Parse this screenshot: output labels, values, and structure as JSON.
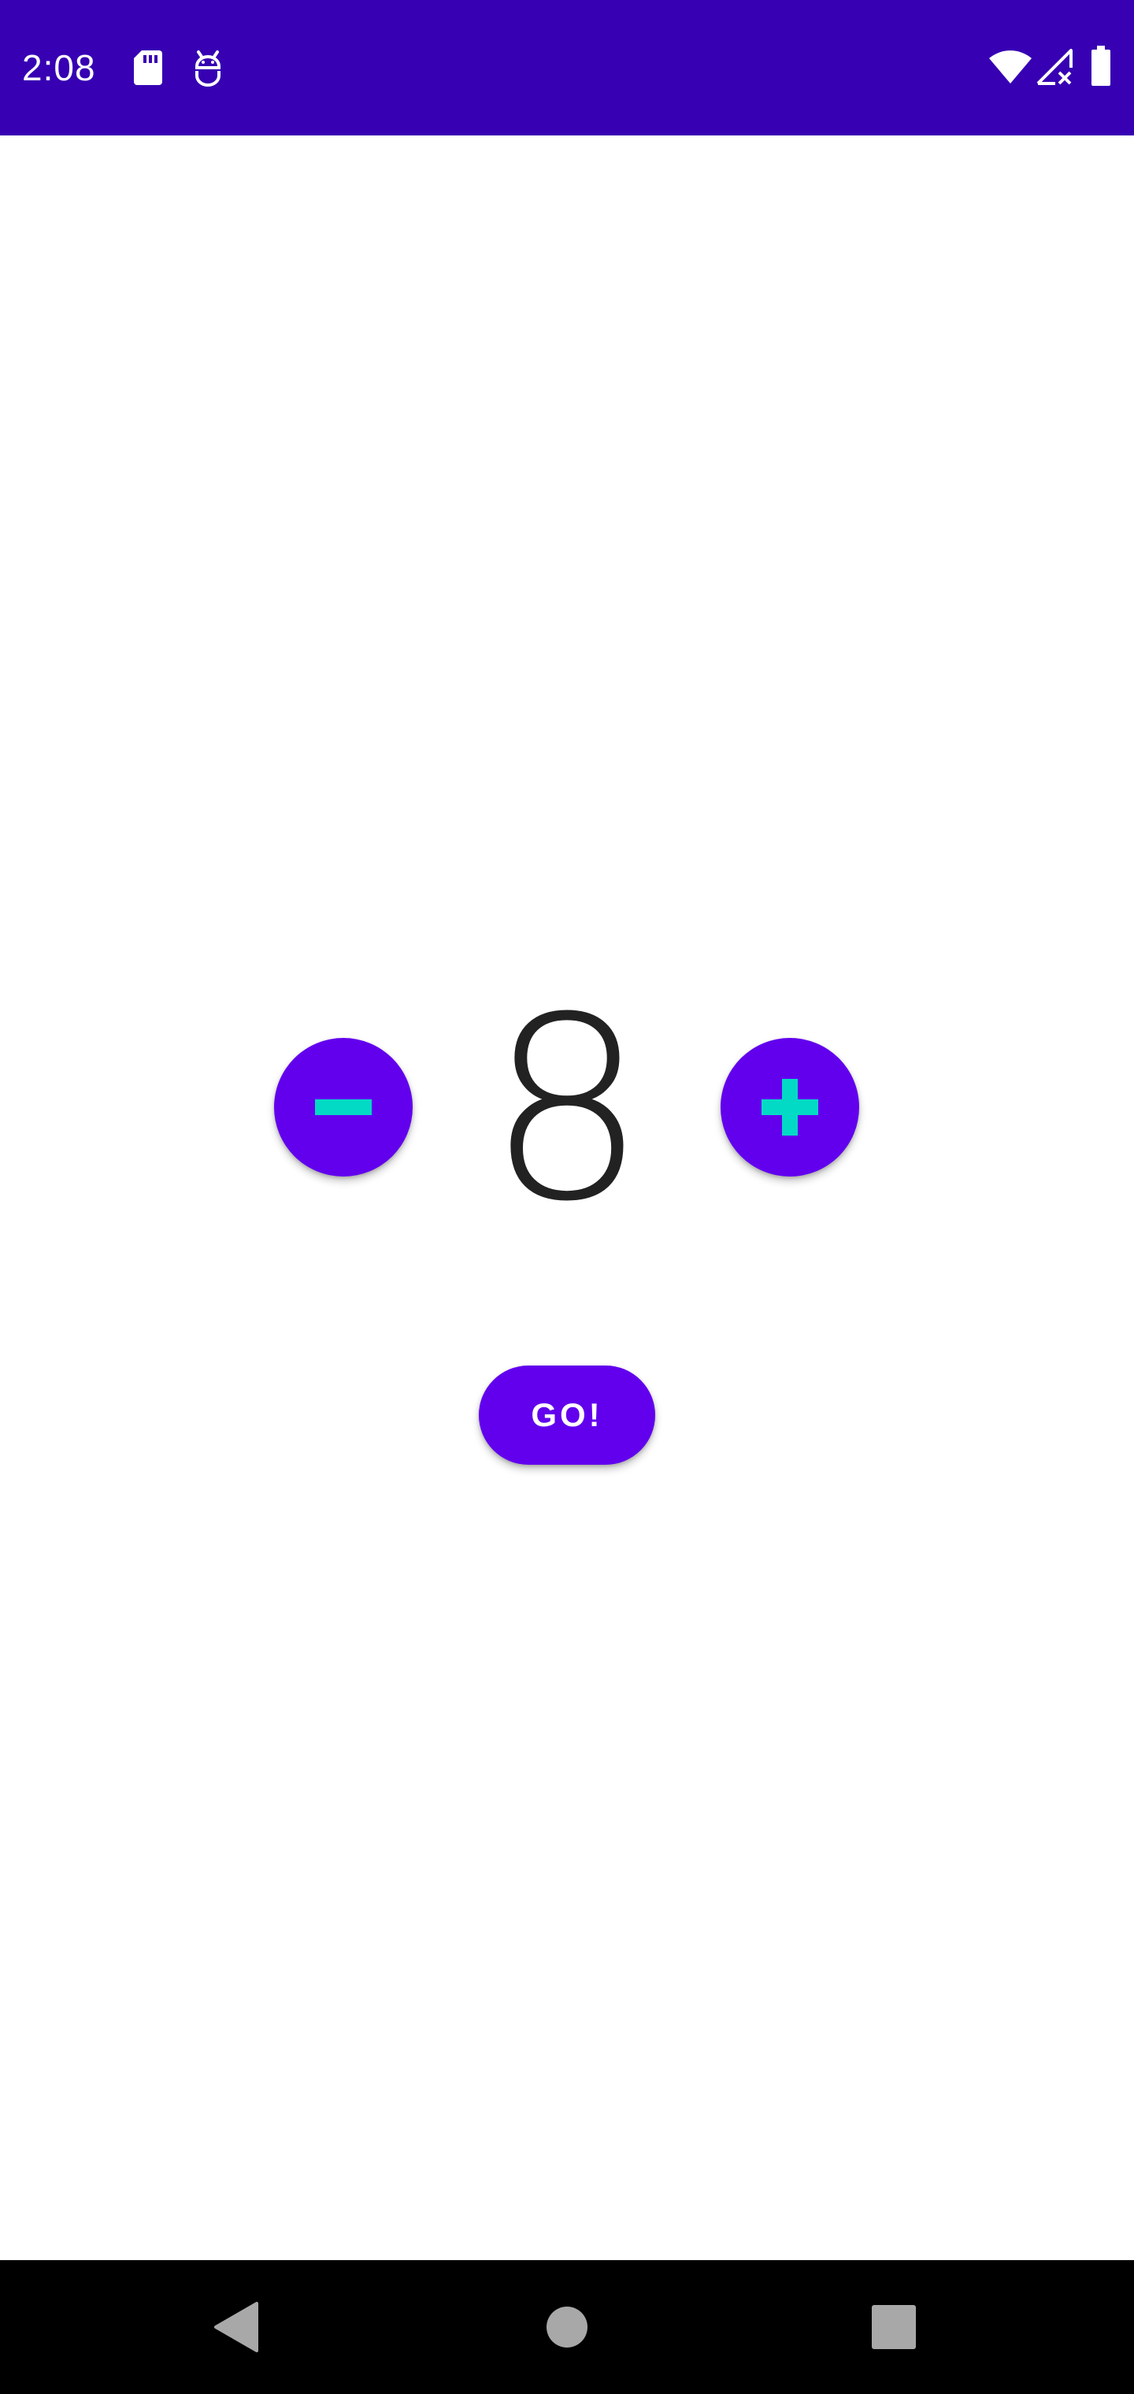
{
  "status_bar": {
    "time": "2:08",
    "left_icons": [
      "sd-card-icon",
      "android-debug-icon"
    ],
    "right_icons": [
      "wifi-icon",
      "cellular-no-signal-icon",
      "battery-icon"
    ],
    "background_color": "#3700b3"
  },
  "counter": {
    "value": "8",
    "decrement_icon": "minus-icon",
    "increment_icon": "plus-icon",
    "button_color": "#6200ee",
    "icon_color": "#03dac5"
  },
  "go_button": {
    "label": "GO!"
  },
  "nav_bar": {
    "icons": [
      "back-icon",
      "home-icon",
      "recent-apps-icon"
    ]
  }
}
